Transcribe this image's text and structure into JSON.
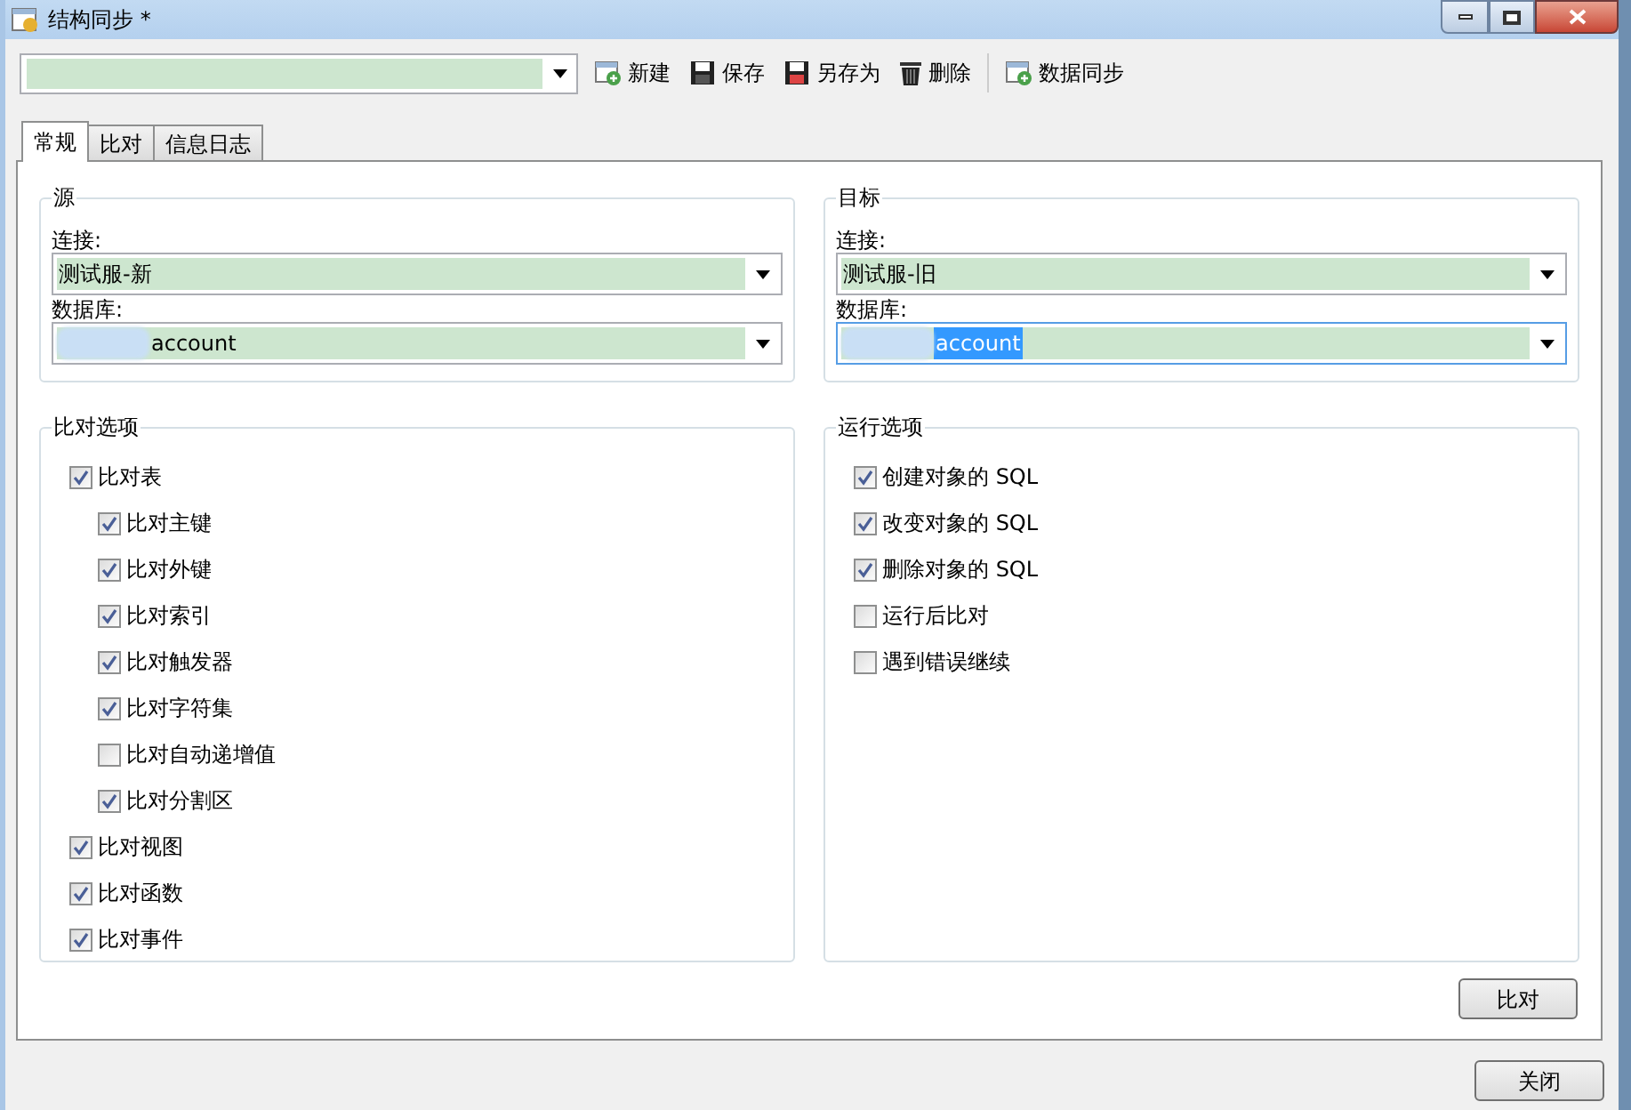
{
  "window": {
    "title": "结构同步 *"
  },
  "toolbar": {
    "buttons": [
      {
        "kind": "new",
        "label": "新建"
      },
      {
        "kind": "save",
        "label": "保存"
      },
      {
        "kind": "saveas",
        "label": "另存为"
      },
      {
        "kind": "delete",
        "label": "删除"
      },
      {
        "kind": "sync",
        "label": "数据同步"
      }
    ]
  },
  "tabs": [
    {
      "label": "常规",
      "selected": true
    },
    {
      "label": "比对",
      "selected": false
    },
    {
      "label": "信息日志",
      "selected": false
    }
  ],
  "source": {
    "title": "源",
    "connection_label": "连接:",
    "connection": "测试服-新",
    "database_label": "数据库:",
    "database": "account",
    "database_text_selected": false
  },
  "target": {
    "title": "目标",
    "connection_label": "连接:",
    "connection": "测试服-旧",
    "database_label": "数据库:",
    "database": "account",
    "database_text_selected": true
  },
  "compare_options": {
    "title": "比对选项",
    "items": [
      {
        "label": "比对表",
        "checked": true,
        "children": [
          {
            "label": "比对主键",
            "checked": true
          },
          {
            "label": "比对外键",
            "checked": true
          },
          {
            "label": "比对索引",
            "checked": true
          },
          {
            "label": "比对触发器",
            "checked": true
          },
          {
            "label": "比对字符集",
            "checked": true
          },
          {
            "label": "比对自动递增值",
            "checked": false
          },
          {
            "label": "比对分割区",
            "checked": true
          }
        ]
      },
      {
        "label": "比对视图",
        "checked": true
      },
      {
        "label": "比对函数",
        "checked": true
      },
      {
        "label": "比对事件",
        "checked": true
      }
    ]
  },
  "run_options": {
    "title": "运行选项",
    "items": [
      {
        "label": "创建对象的 SQL",
        "checked": true
      },
      {
        "label": "改变对象的 SQL",
        "checked": true
      },
      {
        "label": "删除对象的 SQL",
        "checked": true
      },
      {
        "label": "运行后比对",
        "checked": false
      },
      {
        "label": "遇到错误继续",
        "checked": false
      }
    ]
  },
  "compare_button": "比对",
  "close_button": "关闭"
}
